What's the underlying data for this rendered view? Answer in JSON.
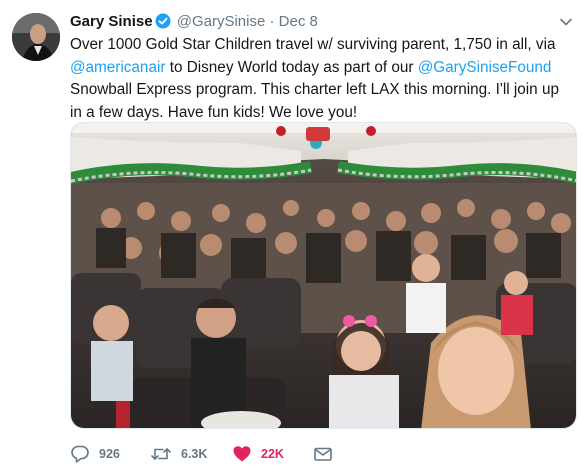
{
  "tweet": {
    "author_name": "Gary Sinise",
    "author_handle": "@GarySinise",
    "separator": "·",
    "date": "Dec 8",
    "text_parts": [
      {
        "type": "text",
        "value": "Over 1000 Gold Star Children travel w/ surviving parent, 1,750 in all, via "
      },
      {
        "type": "mention",
        "value": "@americanair"
      },
      {
        "type": "text",
        "value": " to Disney World today as part of our "
      },
      {
        "type": "mention",
        "value": "@GarySiniseFound"
      },
      {
        "type": "text",
        "value": " Snowball Express program. This charter left LAX this morning. I'll join up in a few days. Have fun kids! We love you!"
      }
    ],
    "image_icon": "airplane-cabin-group-photo"
  },
  "actions": {
    "reply_count": "926",
    "retweet_count": "6.3K",
    "like_count": "22K",
    "reply_icon": "speech-bubble-icon",
    "retweet_icon": "retweet-arrows-icon",
    "like_icon": "heart-icon",
    "dm_icon": "envelope-icon"
  },
  "colors": {
    "accent": "#1da1f2",
    "liked": "#e0245e",
    "muted": "#657786",
    "text": "#14171a"
  }
}
